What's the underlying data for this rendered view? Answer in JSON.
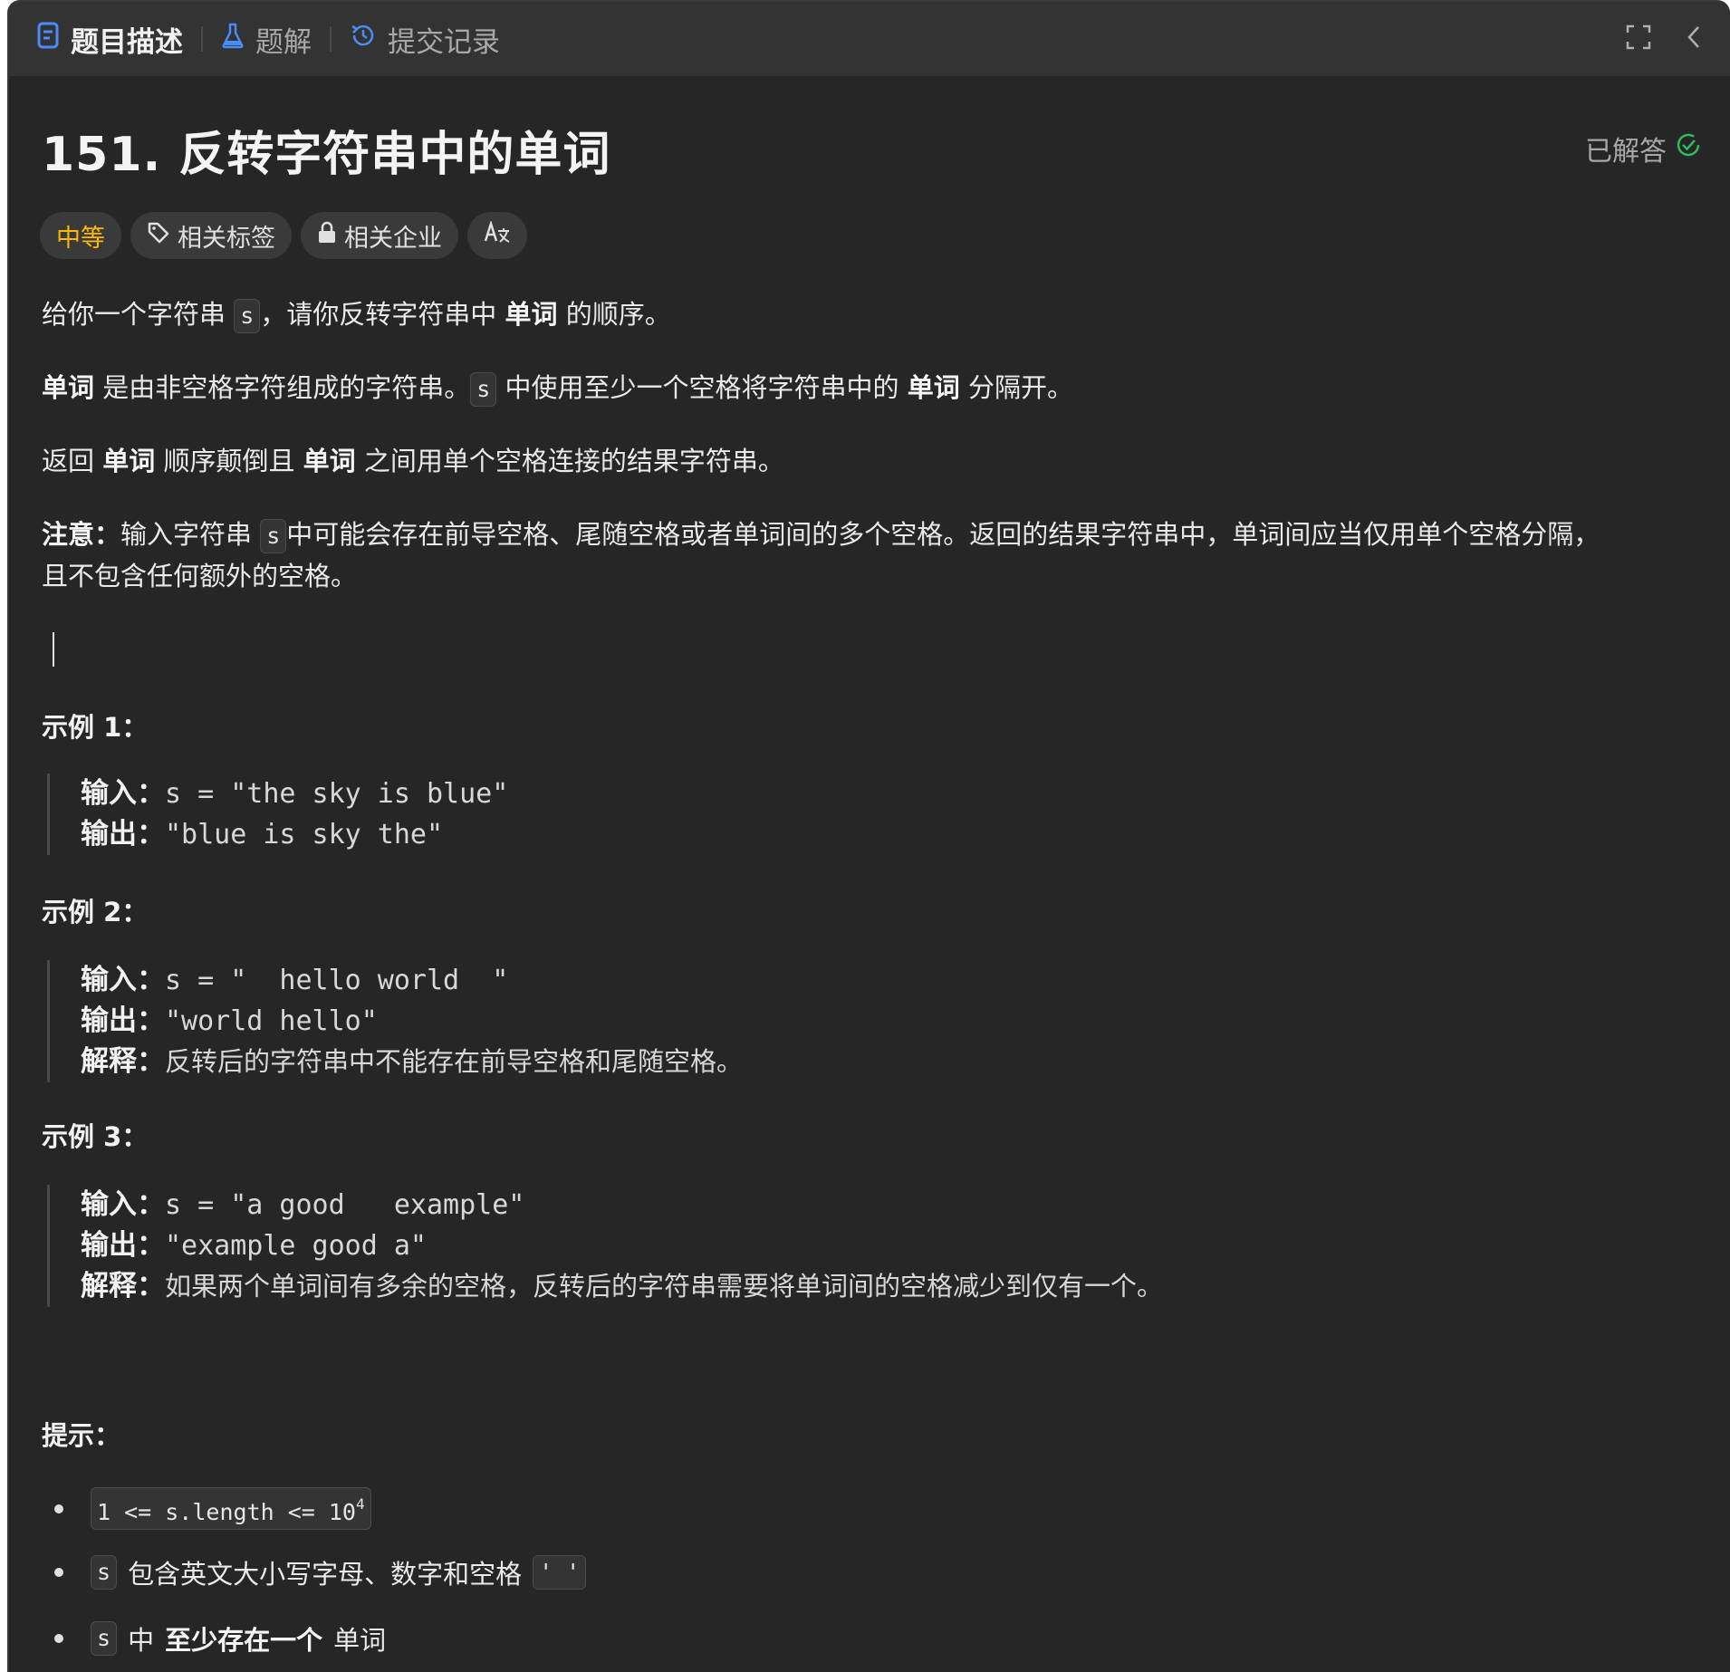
{
  "tabs": [
    {
      "label": "题目描述",
      "icon": "document-icon",
      "active": true
    },
    {
      "label": "题解",
      "icon": "flask-icon",
      "active": false
    },
    {
      "label": "提交记录",
      "icon": "history-icon",
      "active": false
    }
  ],
  "problem": {
    "title": "151. 反转字符串中的单词",
    "status": "已解答",
    "status_color": "#2cbb5d",
    "difficulty": "中等",
    "difficulty_color": "#ffb800",
    "tags": [
      "相关标签",
      "相关企业"
    ],
    "translate_label": "A文"
  },
  "description": {
    "p1": {
      "a": "给你一个字符串 ",
      "code": "s",
      "b": "，请你反转字符串中 ",
      "bold": "单词",
      "c": " 的顺序。"
    },
    "p2": {
      "bold1": "单词",
      "a": " 是由非空格字符组成的字符串。",
      "code": "s",
      "b": " 中使用至少一个空格将字符串中的 ",
      "bold2": "单词",
      "c": " 分隔开。"
    },
    "p3": {
      "a": "返回 ",
      "bold1": "单词",
      "b": " 顺序颠倒且 ",
      "bold2": "单词",
      "c": " 之间用单个空格连接的结果字符串。"
    },
    "p4": {
      "bold": "注意：",
      "a": "输入字符串 ",
      "code": "s",
      "b": "中可能会存在前导空格、尾随空格或者单词间的多个空格。返回的结果字符串中，单词间应当仅用单个空格分隔，",
      "line2": "且不包含任何额外的空格。"
    }
  },
  "examples": [
    {
      "heading": "示例 1：",
      "input_label": "输入：",
      "input": "s = \"the sky is blue\"",
      "output_label": "输出：",
      "output": "\"blue is sky the\""
    },
    {
      "heading": "示例 2：",
      "input_label": "输入：",
      "input": "s = \"  hello world  \"",
      "output_label": "输出：",
      "output": "\"world hello\"",
      "explain_label": "解释：",
      "explain": "反转后的字符串中不能存在前导空格和尾随空格。"
    },
    {
      "heading": "示例 3：",
      "input_label": "输入：",
      "input": "s = \"a good   example\"",
      "output_label": "输出：",
      "output": "\"example good a\"",
      "explain_label": "解释：",
      "explain": "如果两个单词间有多余的空格，反转后的字符串需要将单词间的空格减少到仅有一个。"
    }
  ],
  "hints": {
    "heading": "提示：",
    "items": [
      {
        "code": "1 <= s.length <= 10",
        "sup": "4"
      },
      {
        "code": "s",
        "text": "包含英文大小写字母、数字和空格",
        "code2": "' '"
      },
      {
        "code": "s",
        "text": "中",
        "bold": "至少存在一个",
        "text2": "单词"
      }
    ]
  }
}
